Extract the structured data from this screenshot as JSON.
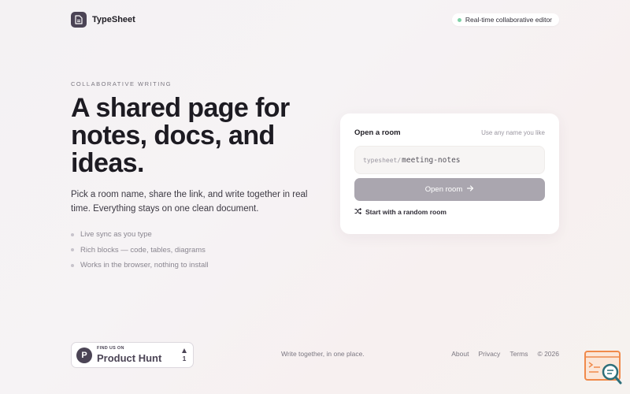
{
  "header": {
    "brand_name": "TypeSheet",
    "status_pill": "Real-time collaborative editor"
  },
  "hero": {
    "eyebrow": "COLLABORATIVE WRITING",
    "headline": "A shared page for notes, docs, and ideas.",
    "subtitle": "Pick a room name, share the link, and write together in real time. Everything stays on one clean document.",
    "features": [
      "Live sync as you type",
      "Rich blocks — code, tables, diagrams",
      "Works in the browser, nothing to install"
    ]
  },
  "room_card": {
    "title": "Open a room",
    "hint": "Use any name you like",
    "prefix": "typesheet/",
    "room_value": "meeting-notes",
    "open_button": "Open room",
    "random_link": "Start with a random room"
  },
  "footer": {
    "product_hunt_small": "FIND US ON",
    "product_hunt_big": "Product Hunt",
    "product_hunt_votes": "1",
    "tagline": "Write together, in one place.",
    "links": [
      "About",
      "Privacy",
      "Terms"
    ],
    "copyright": "© 2026"
  },
  "colors": {
    "brand": "#4b4455",
    "button_disabled": "#aaa6af",
    "status_dot": "#7fd1a6",
    "widget_accent": "#f08a4b"
  },
  "icons": [
    "document-icon",
    "status-dot",
    "arrow-right-icon",
    "shuffle-icon",
    "product-hunt-logo",
    "upvote-arrow-icon",
    "code-search-icon"
  ]
}
